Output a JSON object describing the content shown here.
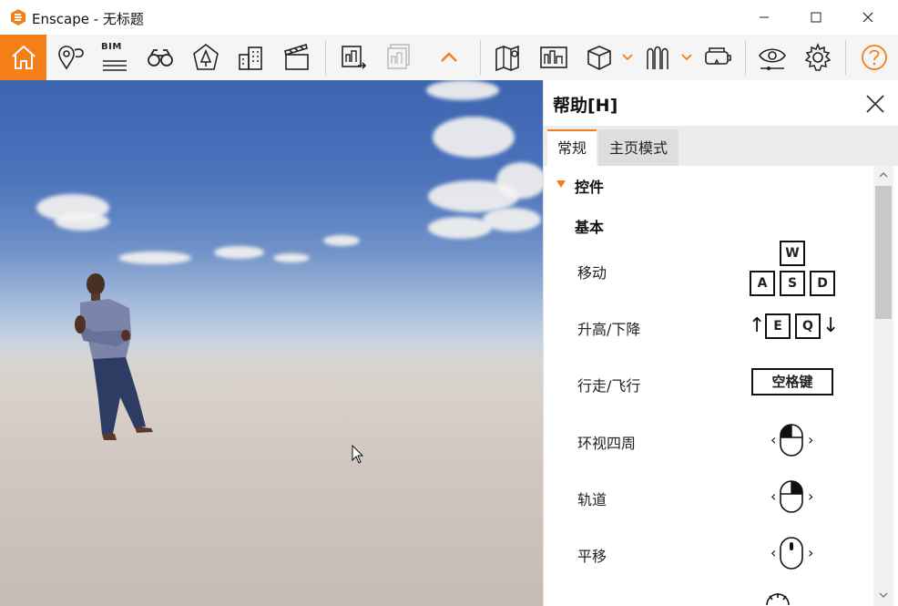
{
  "window": {
    "title": "Enscape - 无标题",
    "minimize_label": "",
    "maximize_label": "",
    "close_label": ""
  },
  "toolbar": {
    "bim_label": "BIM",
    "buttons": [
      {
        "icon": "home-icon"
      },
      {
        "icon": "map-pin-icon"
      },
      {
        "icon": "bim-icon"
      },
      {
        "icon": "binoculars-icon"
      },
      {
        "icon": "sun-icon"
      },
      {
        "icon": "buildings-icon"
      },
      {
        "icon": "clapperboard-icon"
      },
      {
        "icon": "export-render-icon"
      },
      {
        "icon": "batch-render-icon"
      },
      {
        "icon": "collapse-up-icon"
      },
      {
        "icon": "map-icon"
      },
      {
        "icon": "panorama-icon"
      },
      {
        "icon": "cube-icon"
      },
      {
        "icon": "clipping-icon"
      },
      {
        "icon": "vr-headset-icon"
      },
      {
        "icon": "eye-icon"
      },
      {
        "icon": "settings-gear-icon"
      },
      {
        "icon": "help-icon"
      }
    ],
    "accent_color": "#f57f17"
  },
  "help_panel": {
    "title": "帮助[H]",
    "tabs": [
      {
        "label": "常规",
        "active": true
      },
      {
        "label": "主页模式",
        "active": false
      }
    ],
    "section": "控件",
    "group": "基本",
    "controls": [
      {
        "label": "移动",
        "keys": [
          "W",
          "A",
          "S",
          "D"
        ]
      },
      {
        "label": "升高/下降",
        "keys": [
          "E",
          "Q"
        ],
        "arrow_up": "↑",
        "arrow_down": "↓"
      },
      {
        "label": "行走/飞行",
        "keys": [
          "空格键"
        ]
      },
      {
        "label": "环视四周",
        "mouse": "left-button",
        "arrow_left": "‹",
        "arrow_right": "›"
      },
      {
        "label": "轨道",
        "mouse": "right-button",
        "arrow_left": "‹",
        "arrow_right": "›"
      },
      {
        "label": "平移",
        "mouse": "middle-button",
        "arrow_left": "‹",
        "arrow_right": "›"
      }
    ]
  }
}
